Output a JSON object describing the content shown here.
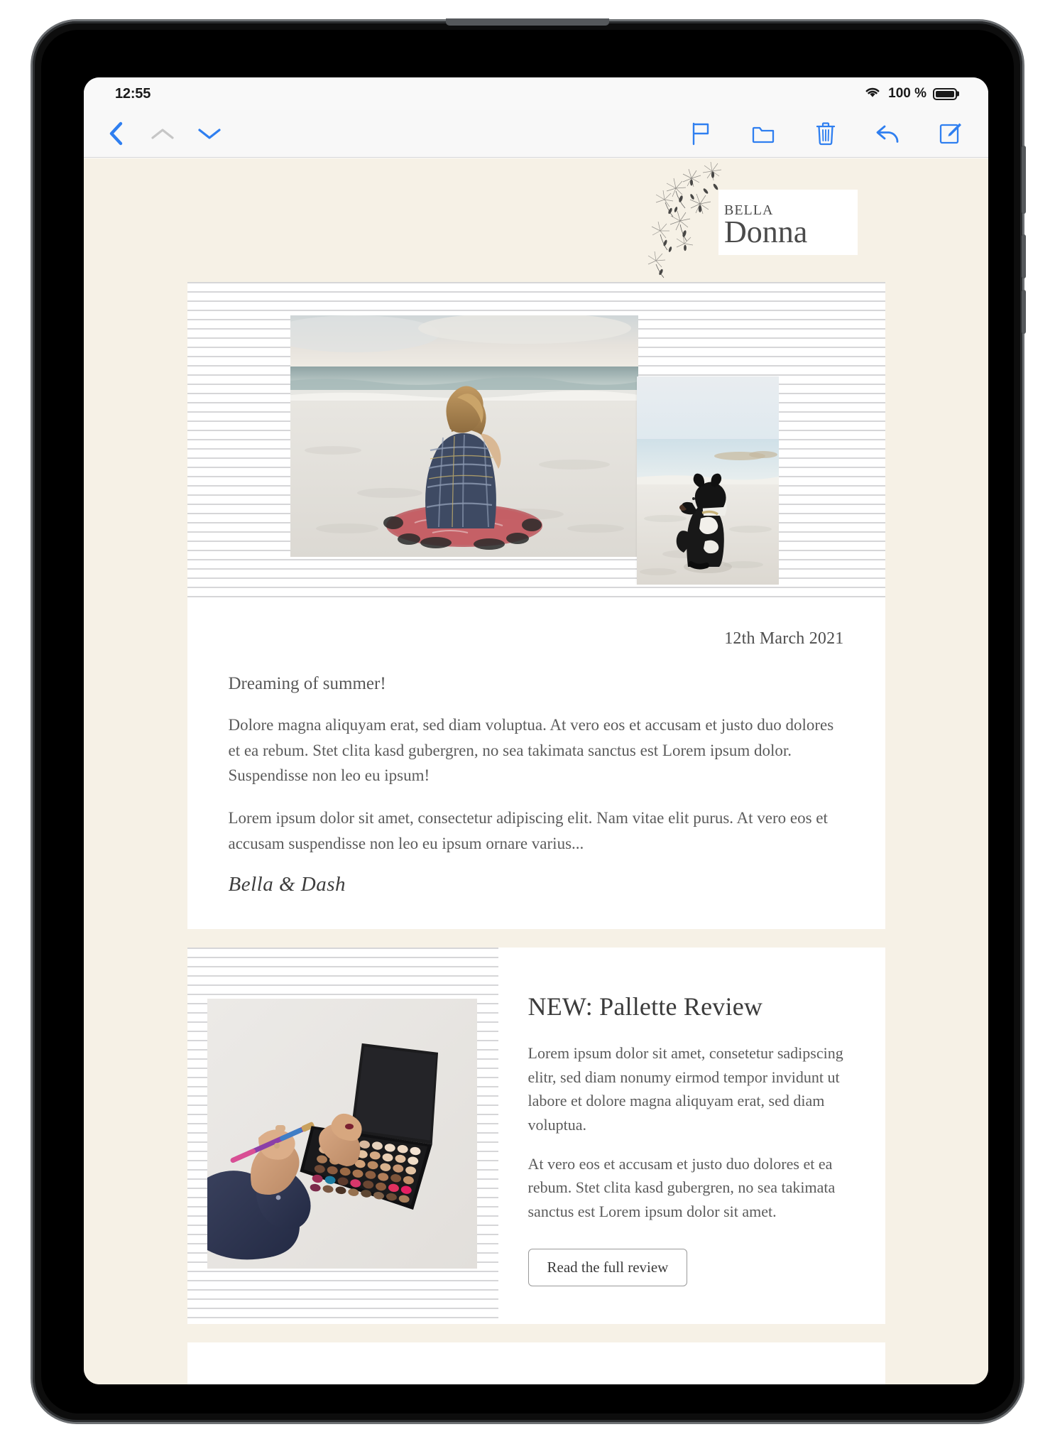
{
  "status_bar": {
    "time": "12:55",
    "wifi_icon": "wifi-icon",
    "battery_percent": "100 %",
    "battery_icon": "battery-full-icon"
  },
  "toolbar": {
    "back_icon": "chevron-left-icon",
    "prev_message_icon": "chevron-up-icon",
    "next_message_icon": "chevron-down-icon",
    "flag_icon": "flag-icon",
    "move_icon": "folder-icon",
    "delete_icon": "trash-icon",
    "reply_icon": "reply-arrow-icon",
    "compose_icon": "compose-pencil-icon",
    "accent_color": "#3b82f6",
    "disabled_color": "#c4c4c4"
  },
  "email": {
    "background_color": "#f6f1e6",
    "logo": {
      "line1": "Bella",
      "line2": "Donna",
      "decoration": "dandelion-seeds-icon"
    },
    "hero": {
      "main_photo_alt": "woman-on-beach-photo",
      "secondary_photo_alt": "dog-on-beach-photo"
    },
    "letter": {
      "date": "12th March 2021",
      "heading": "Dreaming of summer!",
      "paragraphs": [
        "Dolore magna aliquyam erat, sed diam voluptua. At vero eos et accusam et justo duo dolores et ea rebum. Stet clita kasd gubergren, no sea takimata sanctus est Lorem ipsum dolor. Suspendisse non leo eu ipsum!",
        "Lorem ipsum dolor sit amet, consectetur adipiscing elit. Nam vitae elit purus. At vero eos et accusam suspendisse non leo eu ipsum ornare varius..."
      ],
      "signature": "Bella & Dash"
    },
    "review": {
      "photo_alt": "hand-holding-makeup-palette-photo",
      "title": "NEW: Pallette Review",
      "paragraphs": [
        "Lorem ipsum dolor sit amet, consetetur sadipscing elitr, sed diam nonumy eirmod tempor invidunt ut labore et dolore magna aliquyam erat, sed diam voluptua.",
        "At vero eos et accusam et justo duo dolores et ea rebum. Stet clita kasd gubergren, no sea takimata sanctus est Lorem ipsum dolor sit amet."
      ],
      "button_label": "Read the full review"
    }
  }
}
